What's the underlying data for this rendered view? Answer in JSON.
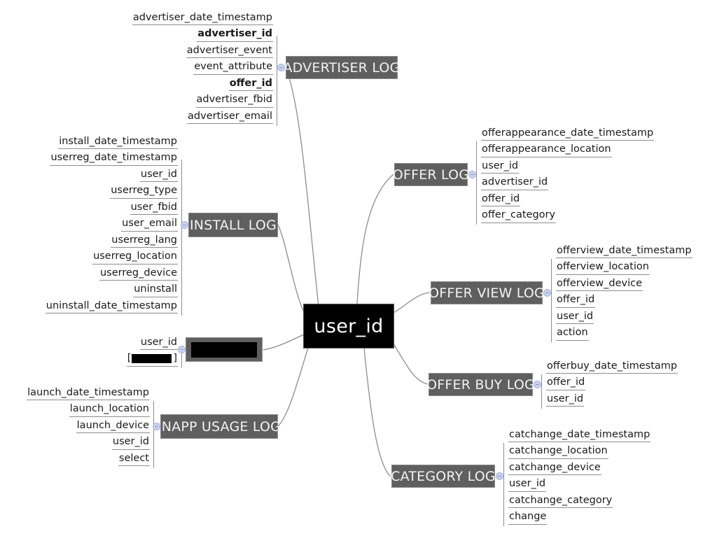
{
  "diagram": {
    "title": "user_id",
    "type": "mind-map",
    "root": {
      "label": "user_id",
      "color": "#000000",
      "text_color": "#ffffff"
    },
    "node_color": "#5f5f5f",
    "node_text_color": "#f2f2f2",
    "connector_color": "#8d8d8d",
    "connector_dot_color": "#c8d2ef",
    "branches": [
      {
        "id": "advertiser-log",
        "label": "ADVERTISER LOG",
        "side": "left",
        "attributes": [
          {
            "name": "advertiser_date_timestamp",
            "bold": false
          },
          {
            "name": "advertiser_id",
            "bold": true
          },
          {
            "name": "advertiser_event",
            "bold": false
          },
          {
            "name": "event_attribute",
            "bold": false
          },
          {
            "name": "offer_id",
            "bold": true
          },
          {
            "name": "advertiser_fbid",
            "bold": false
          },
          {
            "name": "advertiser_email",
            "bold": false
          }
        ]
      },
      {
        "id": "install-log",
        "label": "INSTALL LOG",
        "side": "left",
        "attributes": [
          {
            "name": "install_date_timestamp",
            "bold": false
          },
          {
            "name": "userreg_date_timestamp",
            "bold": false
          },
          {
            "name": "user_id",
            "bold": false
          },
          {
            "name": "userreg_type",
            "bold": false
          },
          {
            "name": "user_fbid",
            "bold": false
          },
          {
            "name": "user_email",
            "bold": false
          },
          {
            "name": "userreg_lang",
            "bold": false
          },
          {
            "name": "userreg_location",
            "bold": false
          },
          {
            "name": "userreg_device",
            "bold": false
          },
          {
            "name": "uninstall",
            "bold": false
          },
          {
            "name": "uninstall_date_timestamp",
            "bold": false
          }
        ]
      },
      {
        "id": "redacted-log",
        "label": "",
        "redacted": true,
        "side": "left",
        "attributes": [
          {
            "name": "user_id",
            "bold": false
          },
          {
            "name": "[",
            "bold": false,
            "redacted": true,
            "suffix": "]"
          }
        ]
      },
      {
        "id": "inapp-usage-log",
        "label": "INAPP USAGE LOG",
        "side": "left",
        "attributes": [
          {
            "name": "launch_date_timestamp",
            "bold": false
          },
          {
            "name": "launch_location",
            "bold": false
          },
          {
            "name": "launch_device",
            "bold": false
          },
          {
            "name": "user_id",
            "bold": false
          },
          {
            "name": "select",
            "bold": false
          }
        ]
      },
      {
        "id": "offer-log",
        "label": "OFFER LOG",
        "side": "right",
        "attributes": [
          {
            "name": "offerappearance_date_timestamp",
            "bold": false
          },
          {
            "name": "offerappearance_location",
            "bold": false
          },
          {
            "name": "user_id",
            "bold": false
          },
          {
            "name": "advertiser_id",
            "bold": false
          },
          {
            "name": "offer_id",
            "bold": false
          },
          {
            "name": "offer_category",
            "bold": false
          }
        ]
      },
      {
        "id": "offer-view-log",
        "label": "OFFER VIEW LOG",
        "side": "right",
        "attributes": [
          {
            "name": "offerview_date_timestamp",
            "bold": false
          },
          {
            "name": "offerview_location",
            "bold": false
          },
          {
            "name": "offerview_device",
            "bold": false
          },
          {
            "name": "offer_id",
            "bold": false
          },
          {
            "name": "user_id",
            "bold": false
          },
          {
            "name": "action",
            "bold": false
          }
        ]
      },
      {
        "id": "offer-buy-log",
        "label": "OFFER BUY LOG",
        "side": "right",
        "attributes": [
          {
            "name": "offerbuy_date_timestamp",
            "bold": false
          },
          {
            "name": "offer_id",
            "bold": false
          },
          {
            "name": "user_id",
            "bold": false
          }
        ]
      },
      {
        "id": "category-log",
        "label": "CATEGORY LOG",
        "side": "right",
        "attributes": [
          {
            "name": "catchange_date_timestamp",
            "bold": false
          },
          {
            "name": "catchange_location",
            "bold": false
          },
          {
            "name": "catchange_device",
            "bold": false
          },
          {
            "name": "user_id",
            "bold": false
          },
          {
            "name": "catchange_category",
            "bold": false
          },
          {
            "name": "change",
            "bold": false
          }
        ]
      }
    ]
  }
}
